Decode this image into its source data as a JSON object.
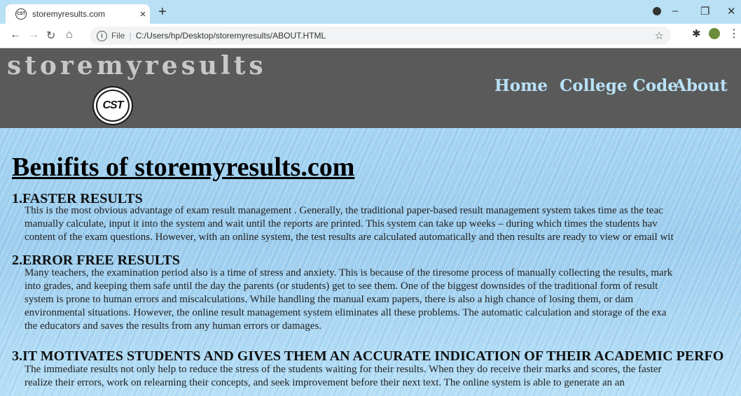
{
  "browser": {
    "tab_title": "storemyresults.com",
    "tab_favicon": "CST",
    "tab_close": "×",
    "new_tab": "+",
    "url_prefix": "File",
    "url": "C:/Users/hp/Desktop/storemyresults/ABOUT.HTML",
    "icons": [
      "back-arrow-icon",
      "forward-arrow-icon",
      "reload-icon",
      "home-icon",
      "info-icon",
      "star-icon",
      "extensions-icon",
      "avatar",
      "menu-icon",
      "minimize-icon",
      "maximize-icon",
      "close-icon"
    ]
  },
  "site": {
    "brand": "storemyresults",
    "logo_text": "CST",
    "nav": [
      "Home",
      "College Code",
      "About"
    ]
  },
  "main": {
    "title": "Benifits of storemyresults.com",
    "sections": [
      {
        "heading": "1.FASTER RESULTS",
        "lines": [
          "This is the most obvious advantage of exam result management . Generally, the traditional paper-based result management system takes time as the teac",
          "manually calculate, input it into the system and wait until the reports are printed. This system can take up weeks – during which times the students hav",
          "content of the exam questions. However, with an online system, the test results are calculated automatically and then results are ready to view or email wit"
        ]
      },
      {
        "heading": "2.ERROR FREE RESULTS",
        "lines": [
          "Many teachers, the examination period also is a time of stress and anxiety. This is because of the tiresome process of manually collecting the results, mark",
          "into grades, and keeping them safe until the day the parents (or students) get to see them. One of the biggest downsides of the traditional form of result",
          "system is prone to human errors and miscalculations. While handling the manual exam papers, there is also a high chance of losing them, or dam",
          "environmental situations. However, the online result management system eliminates all these problems. The automatic calculation and storage of the exa",
          "the educators and saves the results from any human errors or damages."
        ]
      },
      {
        "heading": "3.IT MOTIVATES STUDENTS AND GIVES THEM AN ACCURATE INDICATION OF THEIR ACADEMIC PERFO",
        "lines": [
          "The immediate results not only help to reduce the stress of the students waiting for their results. When they do receive their marks and scores, the faster",
          "realize their errors, work on relearning their concepts, and seek improvement before their next text. The online system is able to generate an an"
        ]
      }
    ]
  }
}
